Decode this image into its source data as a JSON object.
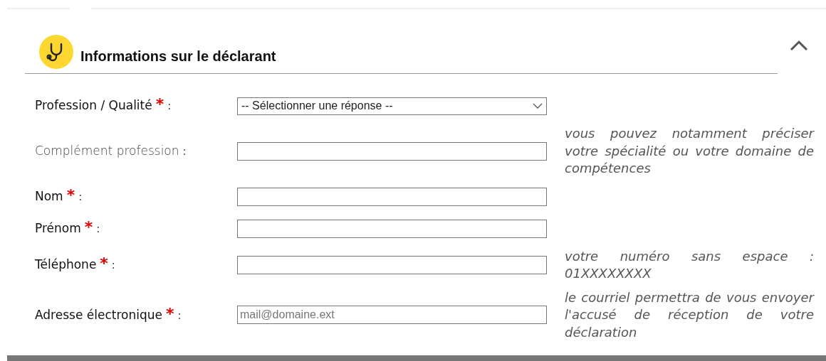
{
  "section": {
    "title": "Informations sur le déclarant",
    "expanded": true
  },
  "fields": [
    {
      "kind": "select",
      "label": "Profession / Qualité",
      "required_mark": "*",
      "colon": ":",
      "value": "-- Sélectionner une réponse --"
    },
    {
      "kind": "input",
      "label": "Complément profession",
      "colon": ":",
      "hint": "vous pouvez notamment préciser votre spécialité ou votre domaine de compétences"
    },
    {
      "kind": "input",
      "label": "Nom",
      "required_mark": "*",
      "colon": ":"
    },
    {
      "kind": "input",
      "label": "Prénom",
      "required_mark": "*",
      "colon": ":"
    },
    {
      "kind": "input",
      "label": "Téléphone",
      "required_mark": "*",
      "colon": ":",
      "hint": "votre numéro sans espace : 01XXXXXXXX"
    },
    {
      "kind": "input",
      "label": "Adresse électronique",
      "required_mark": "*",
      "colon": ":",
      "placeholder": "mail@domaine.ext",
      "hint": "le courriel permettra de vous envoyer l'accusé de réception de votre déclaration"
    }
  ]
}
